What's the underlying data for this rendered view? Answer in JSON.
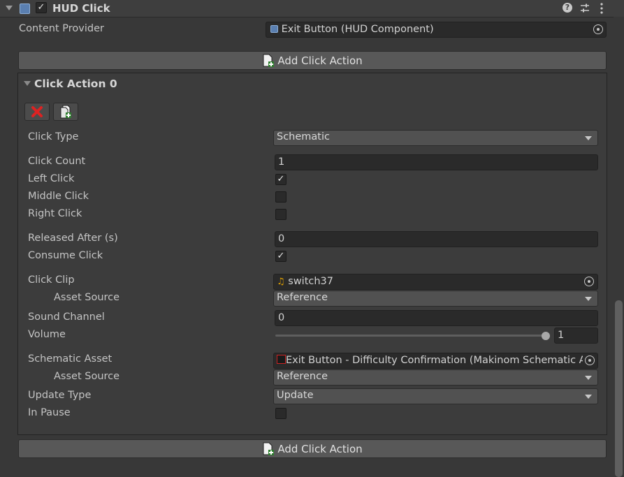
{
  "component": {
    "title": "HUD Click",
    "enabled": true
  },
  "content_provider": {
    "label": "Content Provider",
    "value": "Exit Button (HUD Component)"
  },
  "add_click_action_label": "Add Click Action",
  "click_action": {
    "title": "Click Action 0",
    "click_type": {
      "label": "Click Type",
      "value": "Schematic"
    },
    "click_count": {
      "label": "Click Count",
      "value": "1"
    },
    "left_click": {
      "label": "Left Click",
      "checked": true
    },
    "middle_click": {
      "label": "Middle Click",
      "checked": false
    },
    "right_click": {
      "label": "Right Click",
      "checked": false
    },
    "released_after": {
      "label": "Released After (s)",
      "value": "0"
    },
    "consume_click": {
      "label": "Consume Click",
      "checked": true
    },
    "click_clip": {
      "label": "Click Clip",
      "value": "switch37"
    },
    "clip_asset_source": {
      "label": "Asset Source",
      "value": "Reference"
    },
    "sound_channel": {
      "label": "Sound Channel",
      "value": "0"
    },
    "volume": {
      "label": "Volume",
      "value": "1",
      "level": 1.0
    },
    "schematic_asset": {
      "label": "Schematic Asset",
      "value": "Exit Button - Difficulty Confirmation (Makinom Schematic As"
    },
    "schematic_asset_source": {
      "label": "Asset Source",
      "value": "Reference"
    },
    "update_type": {
      "label": "Update Type",
      "value": "Update"
    },
    "in_pause": {
      "label": "In Pause",
      "checked": false
    }
  },
  "check_glyph": "✓"
}
